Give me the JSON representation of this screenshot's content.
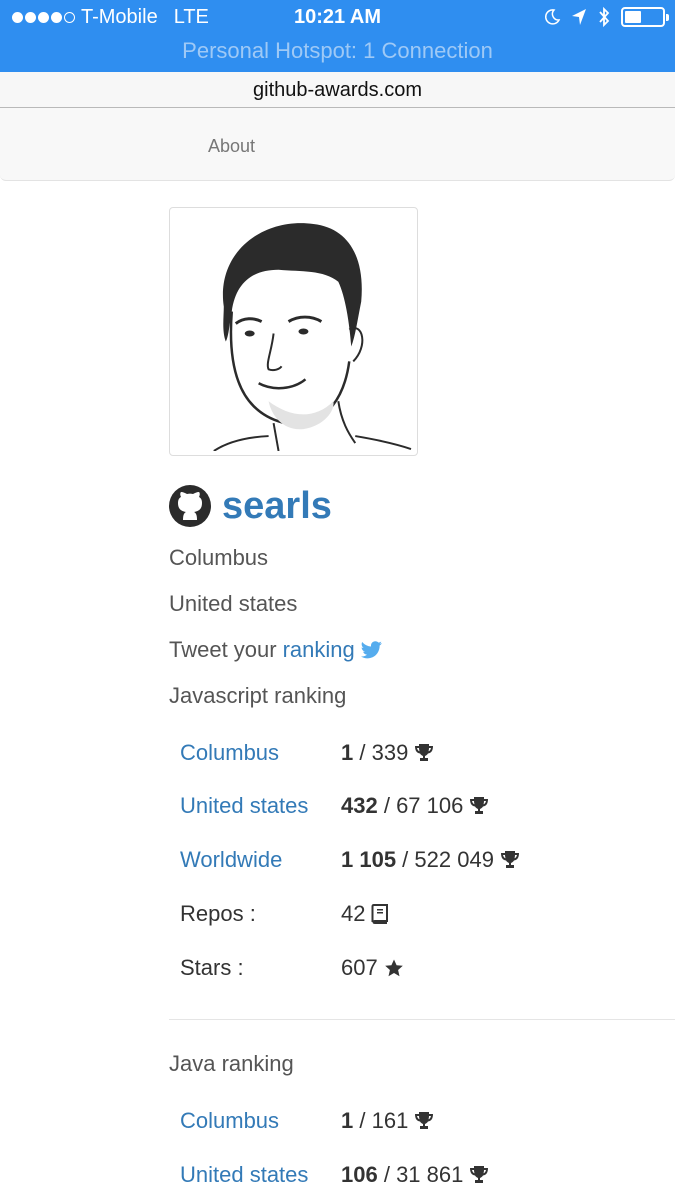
{
  "status_bar": {
    "carrier": "T-Mobile",
    "network": "LTE",
    "time": "10:21 AM",
    "signal_bars": 4,
    "battery_level": 0.45,
    "hotspot_text": "Personal Hotspot: 1 Connection"
  },
  "browser": {
    "url": "github-awards.com"
  },
  "nav": {
    "about": "About"
  },
  "profile": {
    "username": "searls",
    "city": "Columbus",
    "country": "United states",
    "tweet_prefix": "Tweet your",
    "tweet_link": "ranking"
  },
  "javascript": {
    "title": "Javascript ranking",
    "rows": [
      {
        "label": "Columbus",
        "rank": "1",
        "total": "339"
      },
      {
        "label": "United states",
        "rank": "432",
        "total": "67 106"
      },
      {
        "label": "Worldwide",
        "rank": "1 105",
        "total": "522 049"
      }
    ],
    "repos_label": "Repos :",
    "repos_value": "42",
    "stars_label": "Stars :",
    "stars_value": "607"
  },
  "java": {
    "title": "Java ranking",
    "rows": [
      {
        "label": "Columbus",
        "rank": "1",
        "total": "161"
      },
      {
        "label": "United states",
        "rank": "106",
        "total": "31 861"
      }
    ]
  },
  "colors": {
    "status_bar": "#2f8ef0",
    "link": "#337ab7",
    "text": "#555555"
  }
}
